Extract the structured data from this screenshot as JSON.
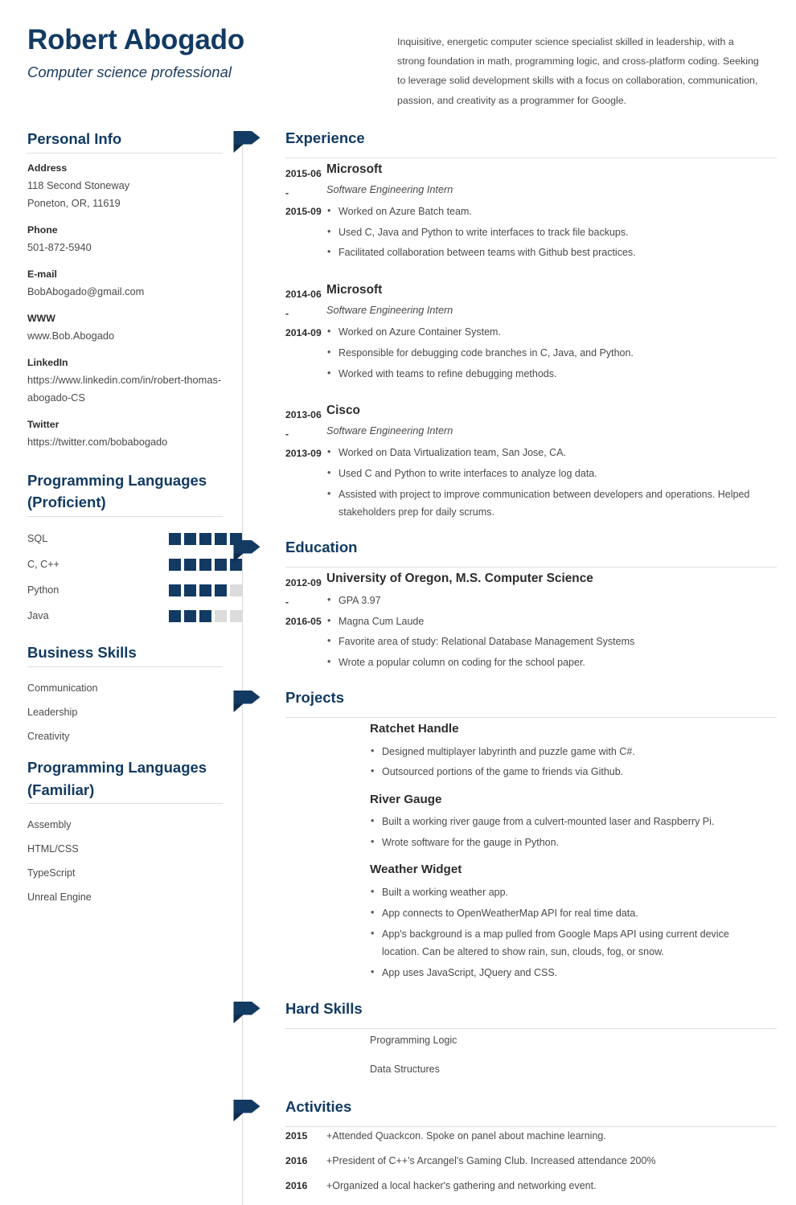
{
  "colors": {
    "accent_navy": "#123a63",
    "flag_navy": "#123a63",
    "flag_fold": "#0d2c4c",
    "text_body": "#4a4a4a",
    "text_strong": "#2c2c2c",
    "rule": "#dedede",
    "skill_filled": "#123a63",
    "skill_empty": "#dcdcdc"
  },
  "header": {
    "name": "Robert Abogado",
    "job_title": "Computer science professional",
    "summary": "Inquisitive, energetic computer science specialist skilled in leadership, with a strong foundation in math, programming logic, and cross-platform coding. Seeking to leverage solid development skills with a focus on collaboration, communication, passion, and creativity as a programmer for Google."
  },
  "sidebar": {
    "personal_info": {
      "heading": "Personal Info",
      "blocks": [
        {
          "label": "Address",
          "lines": [
            "118 Second Stoneway",
            "Poneton, OR, 11619"
          ]
        },
        {
          "label": "Phone",
          "lines": [
            "501-872-5940"
          ]
        },
        {
          "label": "E-mail",
          "lines": [
            "BobAbogado@gmail.com"
          ]
        },
        {
          "label": "WWW",
          "lines": [
            "www.Bob.Abogado"
          ]
        },
        {
          "label": "LinkedIn",
          "lines": [
            "https://www.linkedin.com/in/robert-thomas-abogado-CS"
          ]
        },
        {
          "label": "Twitter",
          "lines": [
            "https://twitter.com/bobabogado"
          ]
        }
      ]
    },
    "languages_proficient": {
      "heading": "Programming Languages (Proficient)",
      "max_level": 5,
      "items": [
        {
          "name": "SQL",
          "level": 5
        },
        {
          "name": "C, C++",
          "level": 5
        },
        {
          "name": "Python",
          "level": 4
        },
        {
          "name": "Java",
          "level": 3
        }
      ]
    },
    "business_skills": {
      "heading": "Business Skills",
      "items": [
        "Communication",
        "Leadership",
        "Creativity"
      ]
    },
    "languages_familiar": {
      "heading": "Programming Languages (Familiar)",
      "items": [
        "Assembly",
        "HTML/CSS",
        "TypeScript",
        "Unreal Engine"
      ]
    }
  },
  "main": {
    "experience": {
      "heading": "Experience",
      "entries": [
        {
          "date_from": "2015-06 -",
          "date_to": "2015-09",
          "org": "Microsoft",
          "role": "Software Engineering Intern",
          "bullets": [
            "Worked on Azure Batch team.",
            "Used C, Java and Python to write interfaces to track file backups.",
            "Facilitated collaboration between teams with Github best practices."
          ]
        },
        {
          "date_from": "2014-06 -",
          "date_to": "2014-09",
          "org": "Microsoft",
          "role": "Software Engineering Intern",
          "bullets": [
            "Worked on Azure Container System.",
            "Responsible for debugging code branches in C, Java, and Python.",
            "Worked with teams to refine debugging methods."
          ]
        },
        {
          "date_from": "2013-06 -",
          "date_to": "2013-09",
          "org": "Cisco",
          "role": "Software Engineering Intern",
          "bullets": [
            "Worked on Data Virtualization team, San Jose, CA.",
            "Used C and Python to write interfaces to analyze log data.",
            "Assisted with project to improve communication between developers and operations. Helped stakeholders prep for daily scrums."
          ]
        }
      ]
    },
    "education": {
      "heading": "Education",
      "entries": [
        {
          "date_from": "2012-09 -",
          "date_to": "2016-05",
          "org": "University of Oregon, M.S. Computer Science",
          "role": "",
          "bullets": [
            "GPA 3.97",
            "Magna Cum Laude",
            "Favorite area of study: Relational Database Management Systems",
            "Wrote a popular column on coding for the school paper."
          ]
        }
      ]
    },
    "projects": {
      "heading": "Projects",
      "entries": [
        {
          "title": "Ratchet Handle",
          "bullets": [
            "Designed multiplayer labyrinth and puzzle game with C#.",
            "Outsourced portions of the game to friends via Github."
          ]
        },
        {
          "title": "River Gauge",
          "bullets": [
            "Built a working river gauge from a culvert-mounted laser and Raspberry Pi.",
            "Wrote software for the gauge in Python."
          ]
        },
        {
          "title": "Weather Widget",
          "bullets": [
            "Built a working weather app.",
            "App connects to OpenWeatherMap API for real time data.",
            "App's background is a map pulled from Google Maps API using current device location. Can be altered to show rain, sun, clouds, fog, or snow.",
            "App uses JavaScript, JQuery and CSS."
          ]
        }
      ]
    },
    "hard_skills": {
      "heading": "Hard Skills",
      "items": [
        "Programming Logic",
        "Data Structures"
      ]
    },
    "activities": {
      "heading": "Activities",
      "rows": [
        {
          "year": "2015",
          "text": "+Attended Quackcon. Spoke on panel about machine learning."
        },
        {
          "year": "2016",
          "text": "+President of C++'s Arcangel's Gaming Club. Increased attendance 200%"
        },
        {
          "year": "2016",
          "text": "+Organized a local hacker's gathering and networking event."
        }
      ]
    }
  }
}
